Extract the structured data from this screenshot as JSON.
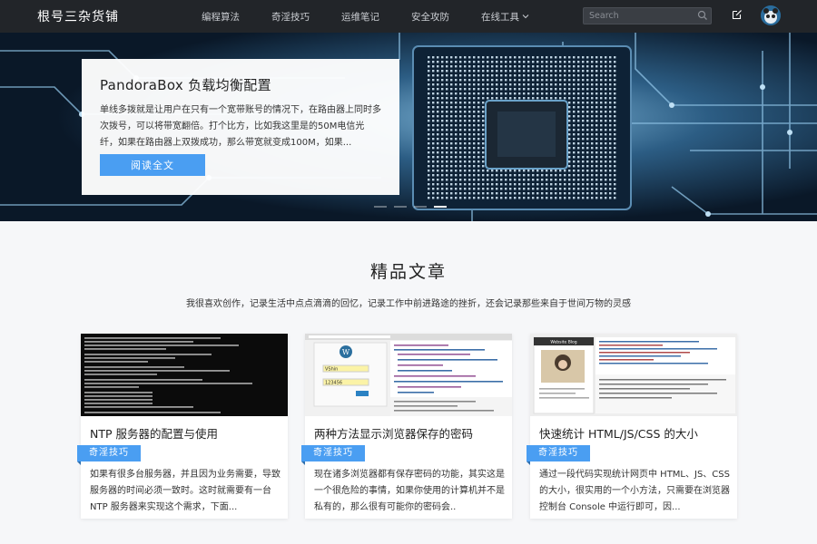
{
  "site": {
    "brand": "根号三杂货铺"
  },
  "nav": {
    "items": [
      {
        "label": "编程算法"
      },
      {
        "label": "奇淫技巧"
      },
      {
        "label": "运维笔记"
      },
      {
        "label": "安全攻防"
      },
      {
        "label": "在线工具"
      }
    ]
  },
  "search": {
    "placeholder": "Search"
  },
  "hero": {
    "title": "PandoraBox 负载均衡配置",
    "excerpt": "单线多拨就是让用户在只有一个宽带账号的情况下，在路由器上同时多次拨号，可以将带宽翻倍。打个比方，比如我这里是的50M电信光纤，如果在路由器上双拨成功，那么带宽就变成100M，如果...",
    "button": "阅读全文"
  },
  "section": {
    "title": "精品文章",
    "subtitle": "我很喜欢创作，记录生活中点点滴滴的回忆，记录工作中前进路途的挫折，还会记录那些来自于世间万物的灵感"
  },
  "cards": [
    {
      "title": "NTP 服务器的配置与使用",
      "tag": "奇淫技巧",
      "desc": "如果有很多台服务器，并且因为业务需要，导致服务器的时间必须一致时。这时就需要有一台 NTP 服务器来实现这个需求，下面..."
    },
    {
      "title": "两种方法显示浏览器保存的密码",
      "tag": "奇淫技巧",
      "desc": "现在诸多浏览器都有保存密码的功能，其实这是一个很危险的事情，如果你使用的计算机并不是私有的，那么很有可能你的密码会..",
      "thumb_fields": [
        "VShin",
        "123456"
      ]
    },
    {
      "title": "快速统计 HTML/JS/CSS 的大小",
      "tag": "奇淫技巧",
      "desc": "通过一段代码实现统计网页中 HTML、JS、CSS 的大小，很实用的一个小方法，只需要在浏览器控制台 Console 中运行即可，因...",
      "thumb_heading": "Website Blog"
    }
  ],
  "colors": {
    "accent": "#4a9ef2",
    "topbar": "#222529"
  }
}
